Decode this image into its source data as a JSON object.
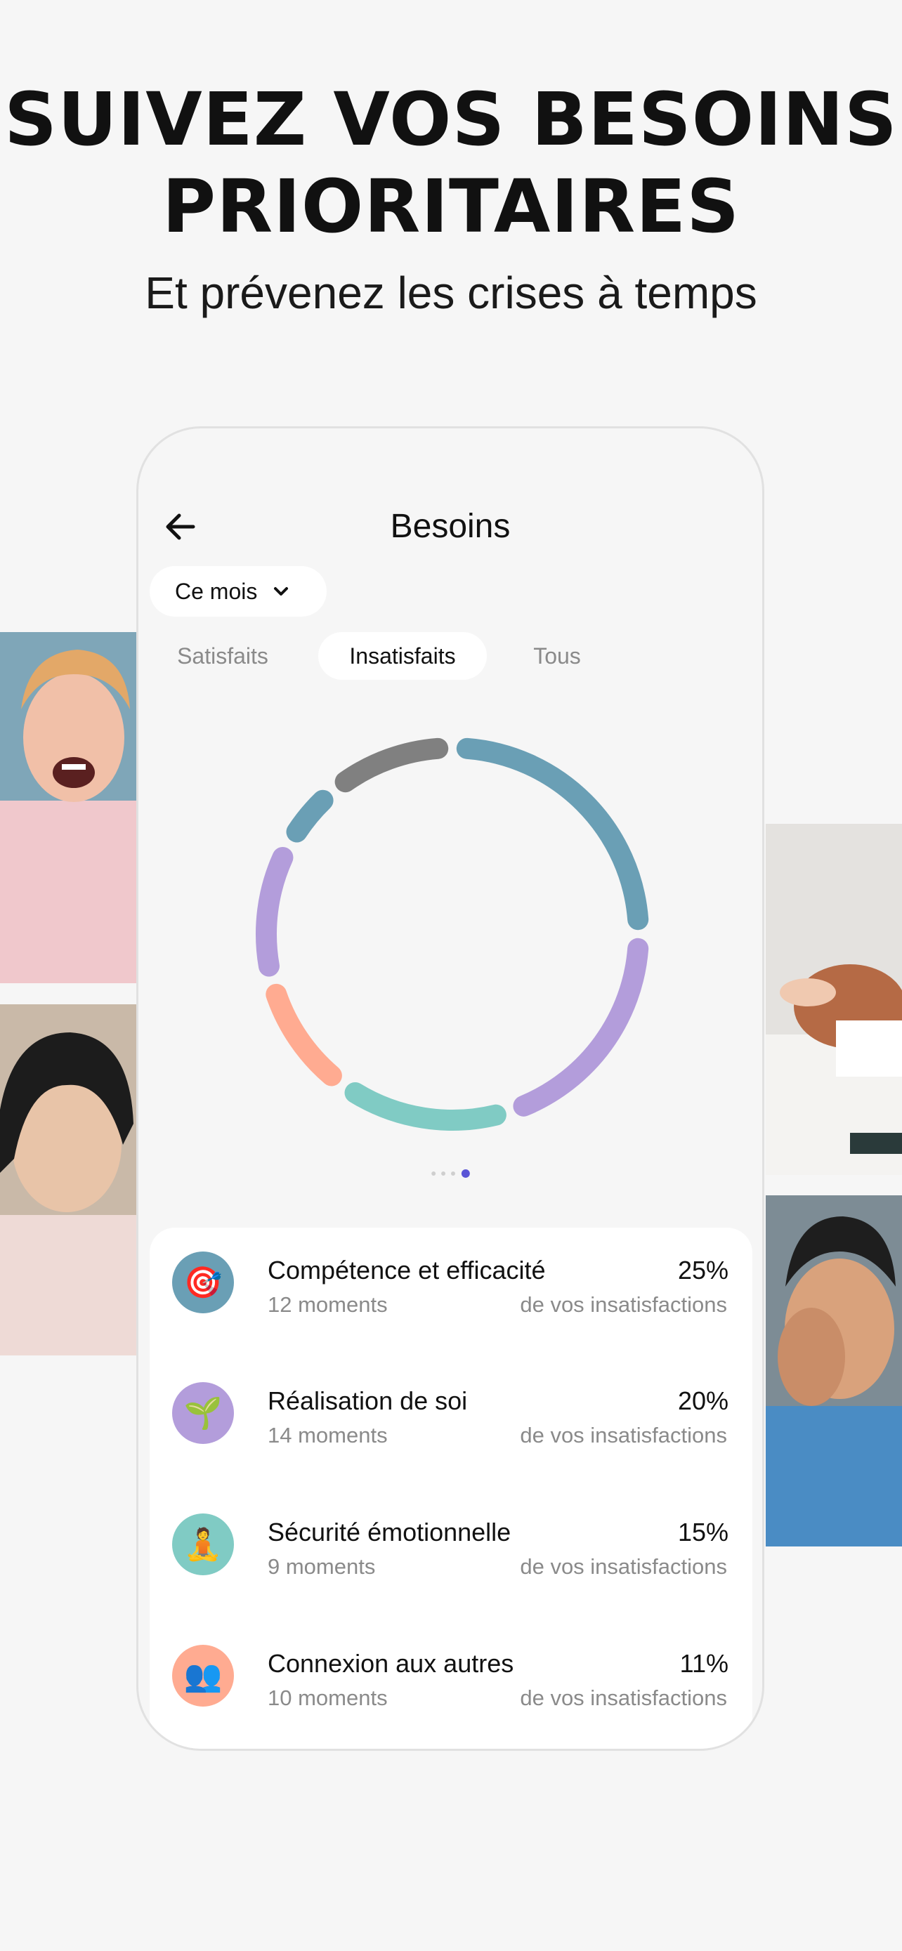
{
  "promo": {
    "headline_line1": "SUIVEZ VOS BESOINS",
    "headline_line2": "PRIORITAIRES",
    "subtitle": "Et prévenez les crises à temps"
  },
  "app": {
    "title": "Besoins",
    "back_icon": "arrow-left-icon",
    "period": {
      "label": "Ce mois",
      "icon": "chevron-down-icon"
    },
    "tabs": [
      {
        "label": "Satisfaits",
        "active": false
      },
      {
        "label": "Insatisfaits",
        "active": true
      },
      {
        "label": "Tous",
        "active": false
      }
    ],
    "page_indicator": {
      "count": 4,
      "active_index": 3,
      "active_color": "#5a55d6"
    },
    "needs": [
      {
        "name": "Compétence et efficacité",
        "moments": "12 moments",
        "percent": "25%",
        "description": "de vos insatisfactions",
        "icon": "🎯",
        "icon_name": "target-icon",
        "color": "#6a9fb5"
      },
      {
        "name": "Réalisation de soi",
        "moments": "14 moments",
        "percent": "20%",
        "description": "de vos insatisfactions",
        "icon": "🌱",
        "icon_name": "seedling-icon",
        "color": "#b39ddb"
      },
      {
        "name": "Sécurité émotionnelle",
        "moments": "9 moments",
        "percent": "15%",
        "description": "de vos insatisfactions",
        "icon": "🧘",
        "icon_name": "meditation-icon",
        "color": "#80cbc4"
      },
      {
        "name": "Connexion aux autres",
        "moments": "10 moments",
        "percent": "11%",
        "description": "de vos insatisfactions",
        "icon": "👥",
        "icon_name": "people-icon",
        "color": "#ffab91"
      }
    ]
  },
  "chart_data": {
    "type": "pie",
    "style": "segmented-ring",
    "values": [
      25,
      20,
      15,
      11,
      12,
      6,
      11
    ],
    "colors": [
      "#6a9fb5",
      "#b39ddb",
      "#80cbc4",
      "#ffab91",
      "#b39ddb",
      "#6a9fb5",
      "#808080"
    ]
  }
}
